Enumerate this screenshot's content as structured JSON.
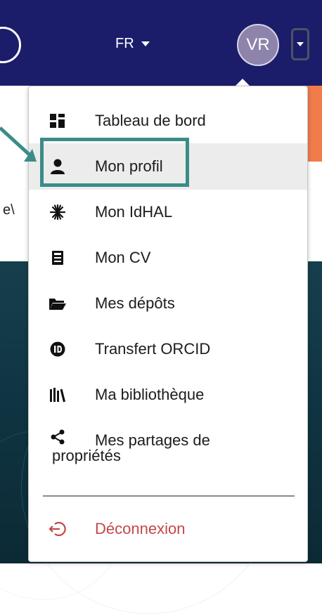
{
  "topbar": {
    "language": "FR",
    "avatar_initials": "VR"
  },
  "background": {
    "partial_text": "e\\"
  },
  "menu": {
    "items": [
      {
        "label": "Tableau de bord",
        "icon": "dashboard-icon"
      },
      {
        "label": "Mon profil",
        "icon": "user-icon",
        "highlighted": true
      },
      {
        "label": "Mon IdHAL",
        "icon": "idhal-icon"
      },
      {
        "label": "Mon CV",
        "icon": "cv-icon"
      },
      {
        "label": "Mes dépôts",
        "icon": "folder-icon"
      },
      {
        "label": "Transfert ORCID",
        "icon": "orcid-icon"
      },
      {
        "label": "Ma bibliothèque",
        "icon": "library-icon"
      },
      {
        "label_line1": "Mes partages de",
        "label_line2": "propriétés",
        "icon": "share-icon"
      }
    ],
    "logout": {
      "label": "Déconnexion",
      "icon": "logout-icon"
    }
  },
  "colors": {
    "navbar": "#1b1d6b",
    "accent_orange": "#f07c4a",
    "highlight_teal": "#3b8c88",
    "logout_red": "#c54747"
  }
}
